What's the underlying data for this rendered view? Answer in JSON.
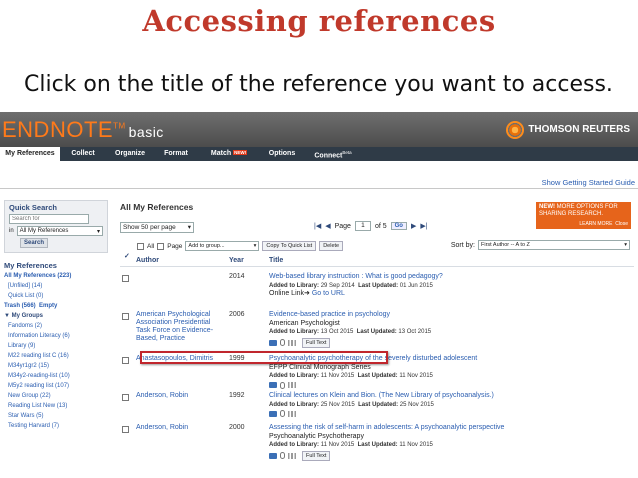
{
  "slide": {
    "title": "Accessing references",
    "instruction": "Click on the title of the reference you want to access."
  },
  "app": {
    "brand": "ENDNOTE",
    "brand_tm": "TM",
    "brand_suffix": "basic",
    "vendor": "THOMSON REUTERS",
    "nav_tabs": [
      {
        "label": "My References",
        "active": true
      },
      {
        "label": "Collect"
      },
      {
        "label": "Organize"
      },
      {
        "label": "Format"
      },
      {
        "label": "Match",
        "badge": "NEW!"
      },
      {
        "label": "Options"
      },
      {
        "label": "Connect",
        "suffix": "Beta"
      }
    ],
    "getting_started": "Show Getting Started Guide"
  },
  "sidebar": {
    "quick_search_title": "Quick Search",
    "search_placeholder": "Search for",
    "in_label": "in",
    "in_value": "All My References",
    "search_button": "Search",
    "my_references_title": "My References",
    "all_refs": "All My References (223)",
    "unfiled": "[Unfiled] (14)",
    "quick_list": "Quick List (0)",
    "trash": "Trash (566)",
    "empty": "Empty",
    "my_groups": "My Groups",
    "groups": [
      "Fandoms (2)",
      "Information Literacy (6)",
      "Library (9)",
      "M22 reading list C (16)",
      "M34yr1gr2 (15)",
      "M34y2-reading-list (10)",
      "M5y2 reading list (107)",
      "New Group (22)",
      "Reading List New (13)",
      "Star Wars (5)",
      "Testing Harvard (7)"
    ]
  },
  "main": {
    "title": "All My References",
    "per_page": "Show 50 per page",
    "page_label": "Page",
    "page_value": "1",
    "of_label": "of 5",
    "go_button": "Go",
    "all_label": "All",
    "page_checkbox_label": "Page",
    "add_to_group": "Add to group...",
    "copy_quick_list": "Copy To Quick List",
    "delete_button": "Delete",
    "sort_label": "Sort by:",
    "sort_value": "First Author -- A to Z",
    "promo_new": "NEW!",
    "promo_text": "MORE OPTIONS FOR SHARING RESEARCH.",
    "promo_learn": "LEARN MORE",
    "promo_close": "Close",
    "columns": {
      "author": "Author",
      "year": "Year",
      "title": "Title"
    },
    "added_label": "Added to Library:",
    "updated_label": "Last Updated:",
    "online_label": "Online Link",
    "goto_url": "Go to URL",
    "full_text": "Full Text",
    "rows": [
      {
        "author": "",
        "year": "2014",
        "title": "Web-based library instruction : What is good pedagogy?",
        "publication": "",
        "added": "29 Sep 2014",
        "updated": "01 Jun 2015",
        "online": true,
        "icons": false
      },
      {
        "author": "American Psychological Association Presidential Task Force on Evidence-Based, Practice",
        "year": "2006",
        "title": "Evidence-based practice in psychology",
        "publication": "American Psychologist",
        "added": "13 Oct 2015",
        "updated": "13 Oct 2015",
        "online": false,
        "icons": true
      },
      {
        "author": "Anastasopoulos, Dimitris",
        "year": "1999",
        "title": "Psychoanalytic psychotherapy of the severely disturbed adolescent",
        "publication": "EFPP Clinical Monograph Series",
        "added": "11 Nov 2015",
        "updated": "11 Nov 2015",
        "online": false,
        "icons": true
      },
      {
        "author": "Anderson, Robin",
        "year": "1992",
        "title": "Clinical lectures on Klein and Bion. (The New Library of psychoanalysis.)",
        "publication": "",
        "added": "25 Nov 2015",
        "updated": "25 Nov 2015",
        "online": false,
        "icons": true
      },
      {
        "author": "Anderson, Robin",
        "year": "2000",
        "title": "Assessing the risk of self-harm in adolescents: A psychoanalytic perspective",
        "publication": "Psychoanalytic Psychotherapy",
        "added": "11 Nov 2015",
        "updated": "11 Nov 2015",
        "online": false,
        "icons": true
      }
    ]
  },
  "colors": {
    "title_red": "#c0392b",
    "nav_bg": "#2f3b47",
    "link_blue": "#2a5db0",
    "highlight_red": "#c0262d",
    "promo_orange": "#e6641b"
  }
}
